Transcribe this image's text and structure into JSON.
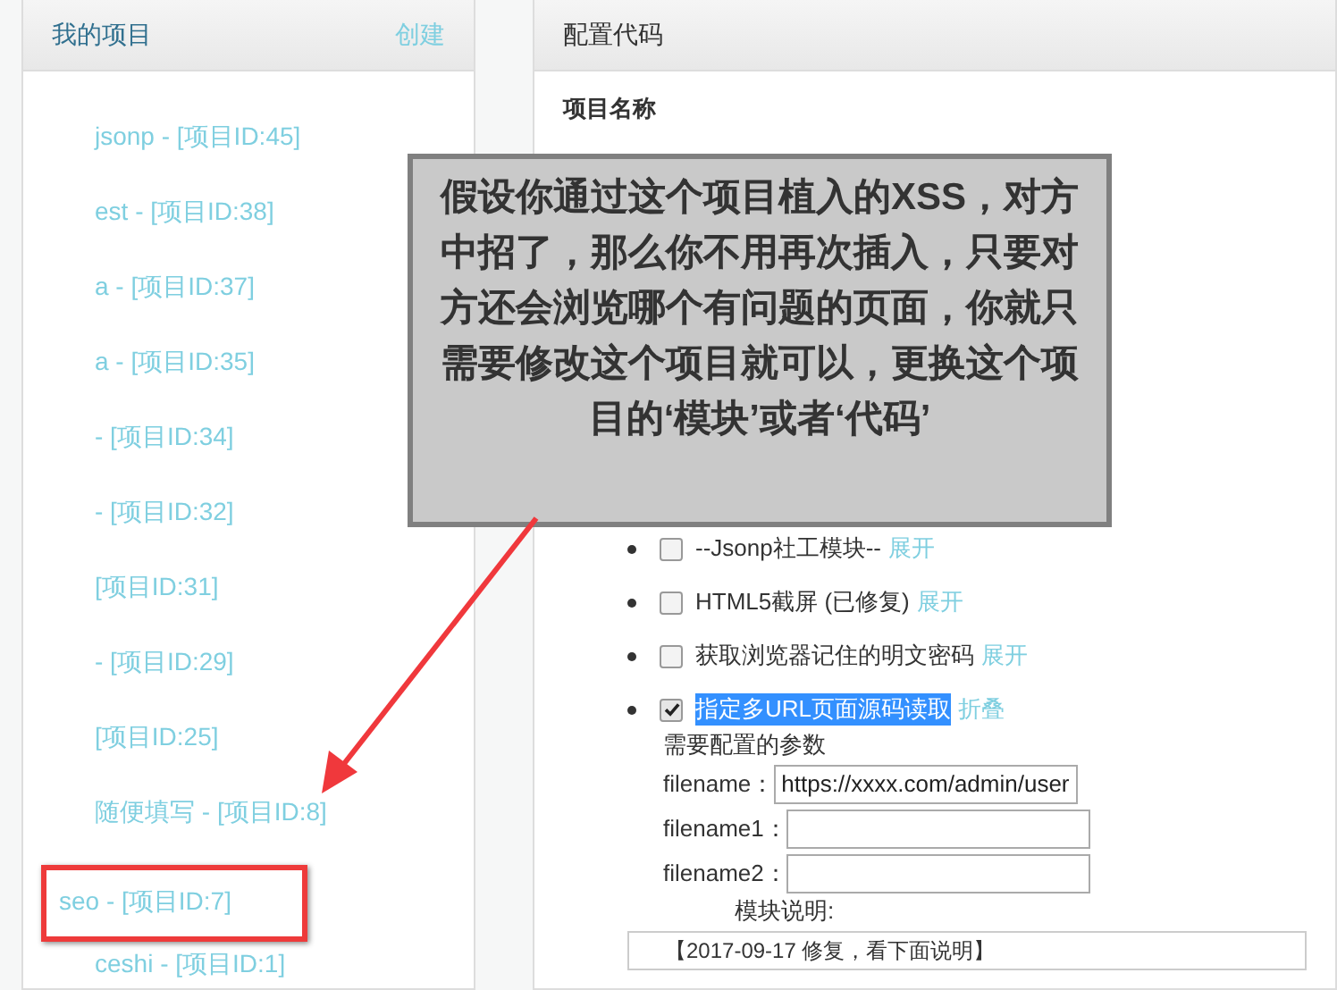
{
  "projects_panel": {
    "title": "我的项目",
    "create_link": "创建",
    "items": [
      {
        "label": "jsonp - [项目ID:45]",
        "highlighted": false
      },
      {
        "label": "est - [项目ID:38]",
        "highlighted": false
      },
      {
        "label": "a - [项目ID:37]",
        "highlighted": false
      },
      {
        "label": "a - [项目ID:35]",
        "highlighted": false
      },
      {
        "label": "- [项目ID:34]",
        "highlighted": false
      },
      {
        "label": "- [项目ID:32]",
        "highlighted": false
      },
      {
        "label": "[项目ID:31]",
        "highlighted": false
      },
      {
        "label": "- [项目ID:29]",
        "highlighted": false
      },
      {
        "label": "[项目ID:25]",
        "highlighted": false
      },
      {
        "label": "随便填写 - [项目ID:8]",
        "highlighted": false
      },
      {
        "label": "seo - [项目ID:7]",
        "highlighted": true
      },
      {
        "label": "ceshi - [项目ID:1]",
        "highlighted": false
      }
    ]
  },
  "config_panel": {
    "title": "配置代码",
    "project_name_label": "项目名称",
    "modules": [
      {
        "label": "--Jsonp社工模块--",
        "checked": false,
        "selected": false,
        "toggle": "展开"
      },
      {
        "label": "HTML5截屏 (已修复)",
        "checked": false,
        "selected": false,
        "toggle": "展开"
      },
      {
        "label": "获取浏览器记住的明文密码",
        "checked": false,
        "selected": false,
        "toggle": "展开"
      },
      {
        "label": "指定多URL页面源码读取",
        "checked": true,
        "selected": true,
        "toggle": "折叠"
      }
    ],
    "params_title": "需要配置的参数",
    "params": [
      {
        "label": "filename：",
        "value": "https://xxxx.com/admin/user"
      },
      {
        "label": "filename1："
      },
      {
        "label": "filename2："
      }
    ],
    "module_desc_label": "模块说明:",
    "module_desc": "【2017-09-17 修复，看下面说明】"
  },
  "annotation": {
    "note": "假设你通过这个项目植入的XSS，对方中招了，那么你不用再次插入，只要对方还会浏览哪个有问题的页面，你就只需要修改这个项目就可以，更换这个项目的‘模块’或者‘代码’"
  }
}
